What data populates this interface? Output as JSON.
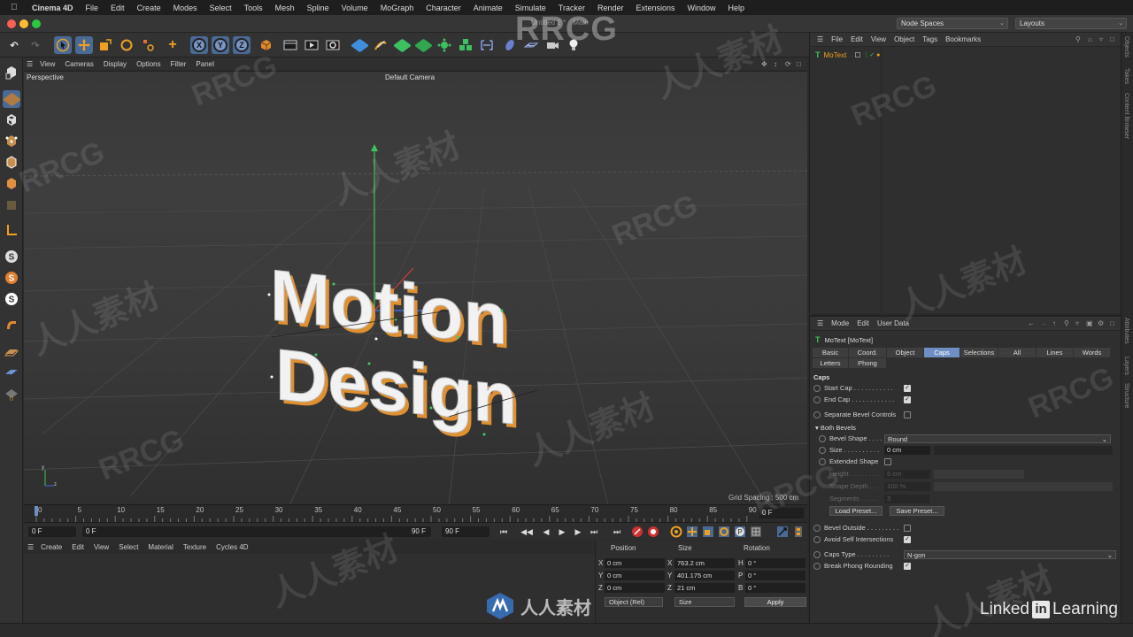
{
  "menubar": {
    "app": "Cinema 4D",
    "items": [
      "File",
      "Edit",
      "Create",
      "Modes",
      "Select",
      "Tools",
      "Mesh",
      "Spline",
      "Volume",
      "MoGraph",
      "Character",
      "Animate",
      "Simulate",
      "Tracker",
      "Render",
      "Extensions",
      "Window",
      "Help"
    ]
  },
  "window": {
    "title": "Untitled 2 *",
    "title_suffix": "Main",
    "node_spaces": "Node Spaces",
    "layouts": "Layouts"
  },
  "viewport": {
    "menu": [
      "View",
      "Cameras",
      "Display",
      "Options",
      "Filter",
      "Panel"
    ],
    "projection": "Perspective",
    "camera": "Default Camera",
    "grid_spacing": "Grid Spacing : 500 cm",
    "text_line1": "Motion",
    "text_line2": "Design"
  },
  "timeline": {
    "ticks": [
      "0",
      "5",
      "10",
      "15",
      "20",
      "25",
      "30",
      "35",
      "40",
      "45",
      "50",
      "55",
      "60",
      "65",
      "70",
      "75",
      "80",
      "85",
      "90"
    ],
    "current_frame": "0 F"
  },
  "transport": {
    "start": "0 F",
    "min": "0 F",
    "max": "90 F",
    "end": "90 F"
  },
  "material_manager": {
    "menu": [
      "Create",
      "Edit",
      "View",
      "Select",
      "Material",
      "Texture",
      "Cycles 4D"
    ]
  },
  "coordinates": {
    "headers": [
      "Position",
      "Size",
      "Rotation"
    ],
    "rows": [
      {
        "axis": "X",
        "pos": "0 cm",
        "size_axis": "X",
        "size": "763.2 cm",
        "rot_axis": "H",
        "rot": "0 °"
      },
      {
        "axis": "Y",
        "pos": "0 cm",
        "size_axis": "Y",
        "size": "401.175 cm",
        "rot_axis": "P",
        "rot": "0 °"
      },
      {
        "axis": "Z",
        "pos": "0 cm",
        "size_axis": "Z",
        "size": "21 cm",
        "rot_axis": "B",
        "rot": "0 °"
      }
    ],
    "mode": "Object (Rel)",
    "size_mode": "Size",
    "apply": "Apply"
  },
  "object_manager": {
    "menu": [
      "File",
      "Edit",
      "View",
      "Object",
      "Tags",
      "Bookmarks"
    ],
    "objects": [
      "MoText"
    ]
  },
  "attribute_manager": {
    "menu": [
      "Mode",
      "Edit",
      "User Data"
    ],
    "object_title": "MoText [MoText]",
    "tabs_row1": [
      "Basic",
      "Coord.",
      "Object",
      "Caps",
      "Selections",
      "All",
      "Lines",
      "Words"
    ],
    "tabs_row2": [
      "Letters",
      "Phong"
    ],
    "active_tab": "Caps",
    "section": "Caps",
    "start_cap": "Start Cap . . . . . . . . . . .",
    "end_cap": "End Cap . . . . . . . . . . . .",
    "separate_bevel": "Separate Bevel Controls",
    "both_bevels": "Both Bevels",
    "bevel_shape_label": "Bevel Shape . . . .",
    "bevel_shape_value": "Round",
    "size_label": "Size . . . . . . . . . .",
    "size_value": "0 cm",
    "extended_shape": "Extended Shape",
    "height_label": "Height . . . . . . . .",
    "height_value": "5 cm",
    "shape_depth_label": "Shape Depth . . .",
    "shape_depth_value": "100 %",
    "segments_label": "Segments . . . . .",
    "segments_value": "3",
    "load_preset": "Load Preset...",
    "save_preset": "Save Preset...",
    "bevel_outside": "Bevel Outside . . . . . . . . .",
    "avoid_self": "Avoid Self Intersections",
    "caps_type_label": "Caps Type . . . . . . . . .",
    "caps_type_value": "N-gon",
    "break_phong": "Break Phong Rounding"
  },
  "side_tabs": [
    "Objects",
    "Takes",
    "Content Browser",
    "Attributes",
    "Layers",
    "Structure"
  ],
  "overlays": {
    "watermark_latin": "RRCG",
    "watermark_cjk": "人人素材",
    "linkedin_pre": "Linked",
    "linkedin_in": "in",
    "linkedin_post": "Learning",
    "brand_text": "人人素材"
  },
  "colors": {
    "accent": "#6f8fc4",
    "text_face": "#f2f2f2",
    "text_outline": "#e09030",
    "traffic_red": "#fd5f57",
    "traffic_yellow": "#febc2e",
    "traffic_green": "#28c840"
  }
}
